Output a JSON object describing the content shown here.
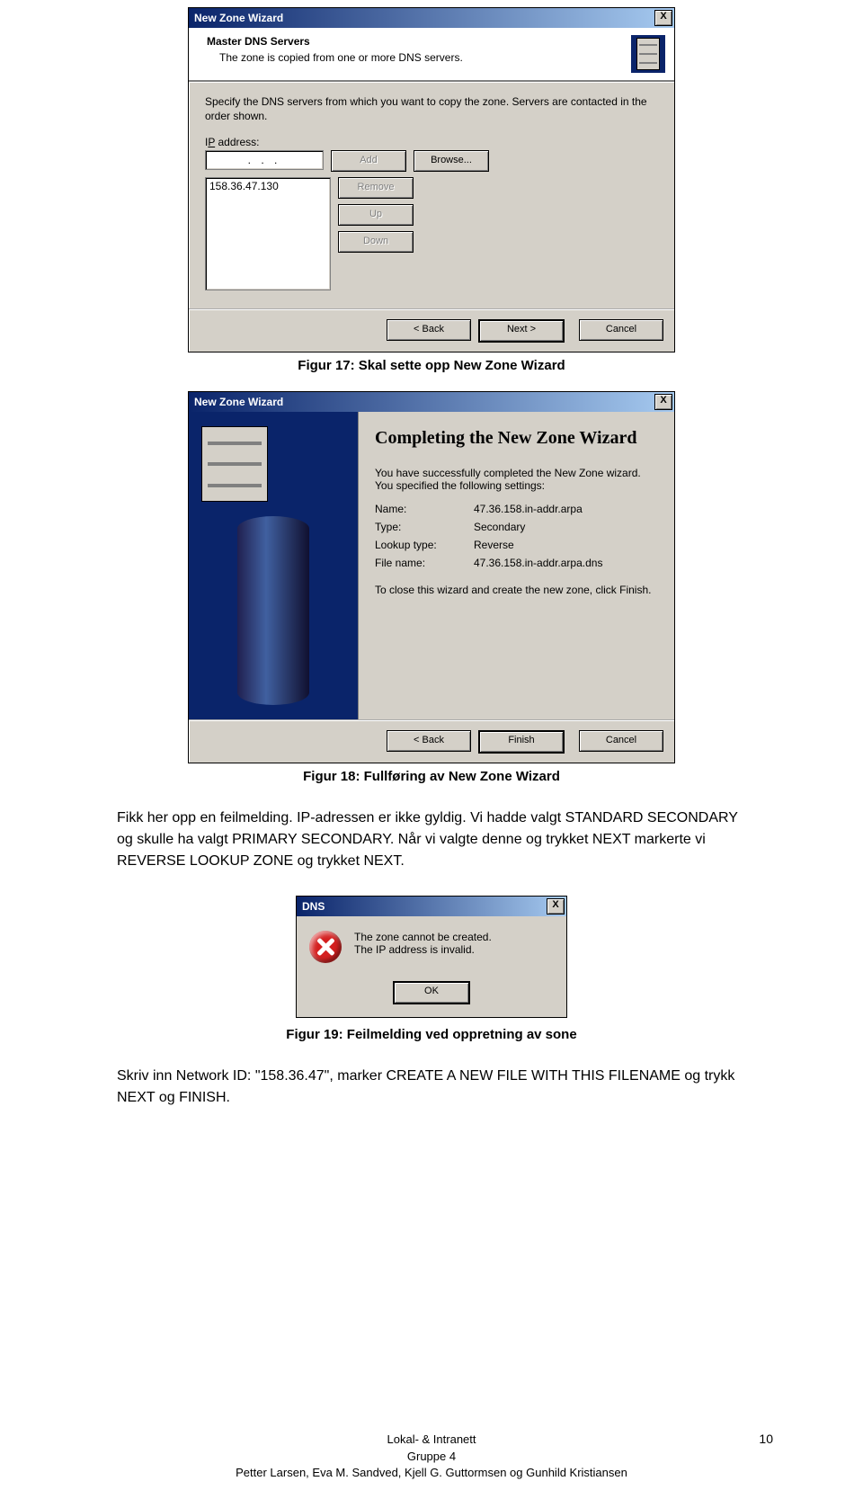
{
  "dialog1": {
    "title": "New Zone Wizard",
    "close": "X",
    "header_title": "Master DNS Servers",
    "header_sub": "The zone is copied from one or more DNS servers.",
    "instruction": "Specify the DNS servers from which you want to copy the zone. Servers are contacted in the order shown.",
    "ip_label": "IP address:",
    "ip_field_placeholder": "  .     .     .",
    "list_value": "158.36.47.130",
    "buttons": {
      "add": "Add",
      "browse": "Browse...",
      "remove": "Remove",
      "up": "Up",
      "down": "Down",
      "back": "< Back",
      "next": "Next >",
      "cancel": "Cancel"
    }
  },
  "caption1": "Figur 17: Skal sette opp New Zone Wizard",
  "dialog2": {
    "title": "New Zone Wizard",
    "close": "X",
    "main_title": "Completing the New Zone Wizard",
    "intro": "You have successfully completed the New Zone wizard. You specified the following settings:",
    "rows": {
      "name_k": "Name:",
      "name_v": "47.36.158.in-addr.arpa",
      "type_k": "Type:",
      "type_v": "Secondary",
      "lookup_k": "Lookup type:",
      "lookup_v": "Reverse",
      "file_k": "File name:",
      "file_v": "47.36.158.in-addr.arpa.dns"
    },
    "note": "To close this wizard and create the new zone, click Finish.",
    "buttons": {
      "back": "< Back",
      "finish": "Finish",
      "cancel": "Cancel"
    }
  },
  "caption2": "Figur 18: Fullføring av New Zone Wizard",
  "para1": "Fikk her opp en feilmelding. IP-adressen er ikke gyldig. Vi hadde valgt STANDARD SECONDARY og skulle ha valgt PRIMARY SECONDARY. Når vi valgte denne og trykket NEXT markerte vi REVERSE LOOKUP ZONE og trykket NEXT.",
  "errorDialog": {
    "title": "DNS",
    "close": "X",
    "line1": "The zone cannot be created.",
    "line2": "The IP address is invalid.",
    "ok": "OK"
  },
  "caption3": "Figur 19: Feilmelding ved oppretning av sone",
  "para2": "Skriv inn Network ID: \"158.36.47\", marker CREATE A NEW FILE WITH THIS FILENAME og trykk NEXT og FINISH.",
  "footer": {
    "l1": "Lokal- & Intranett",
    "l2": "Gruppe 4",
    "l3": "Petter Larsen, Eva M. Sandved, Kjell G. Guttormsen og Gunhild Kristiansen",
    "page": "10"
  }
}
